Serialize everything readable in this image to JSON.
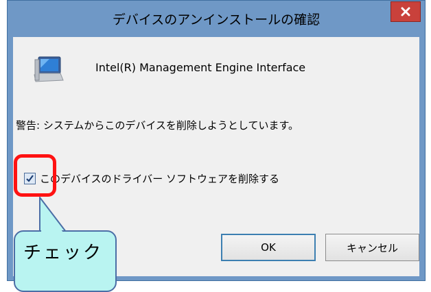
{
  "dialog": {
    "title": "デバイスのアンインストールの確認",
    "close_label": "x",
    "device_name": "Intel(R) Management Engine Interface",
    "device_icon": "monitor-icon",
    "warning": "警告: システムからこのデバイスを削除しようとしています。",
    "checkbox": {
      "label": "このデバイスのドライバー ソフトウェアを削除する",
      "checked": true
    },
    "ok_label": "OK",
    "cancel_label": "キャンセル"
  },
  "annotation": {
    "callout_text": "チェック",
    "highlight_color": "#ff1212",
    "callout_fill": "#b9f4f1"
  },
  "colors": {
    "frame": "#6f98c6",
    "close_button": "#c9413b",
    "client": "#f0f0f0"
  }
}
